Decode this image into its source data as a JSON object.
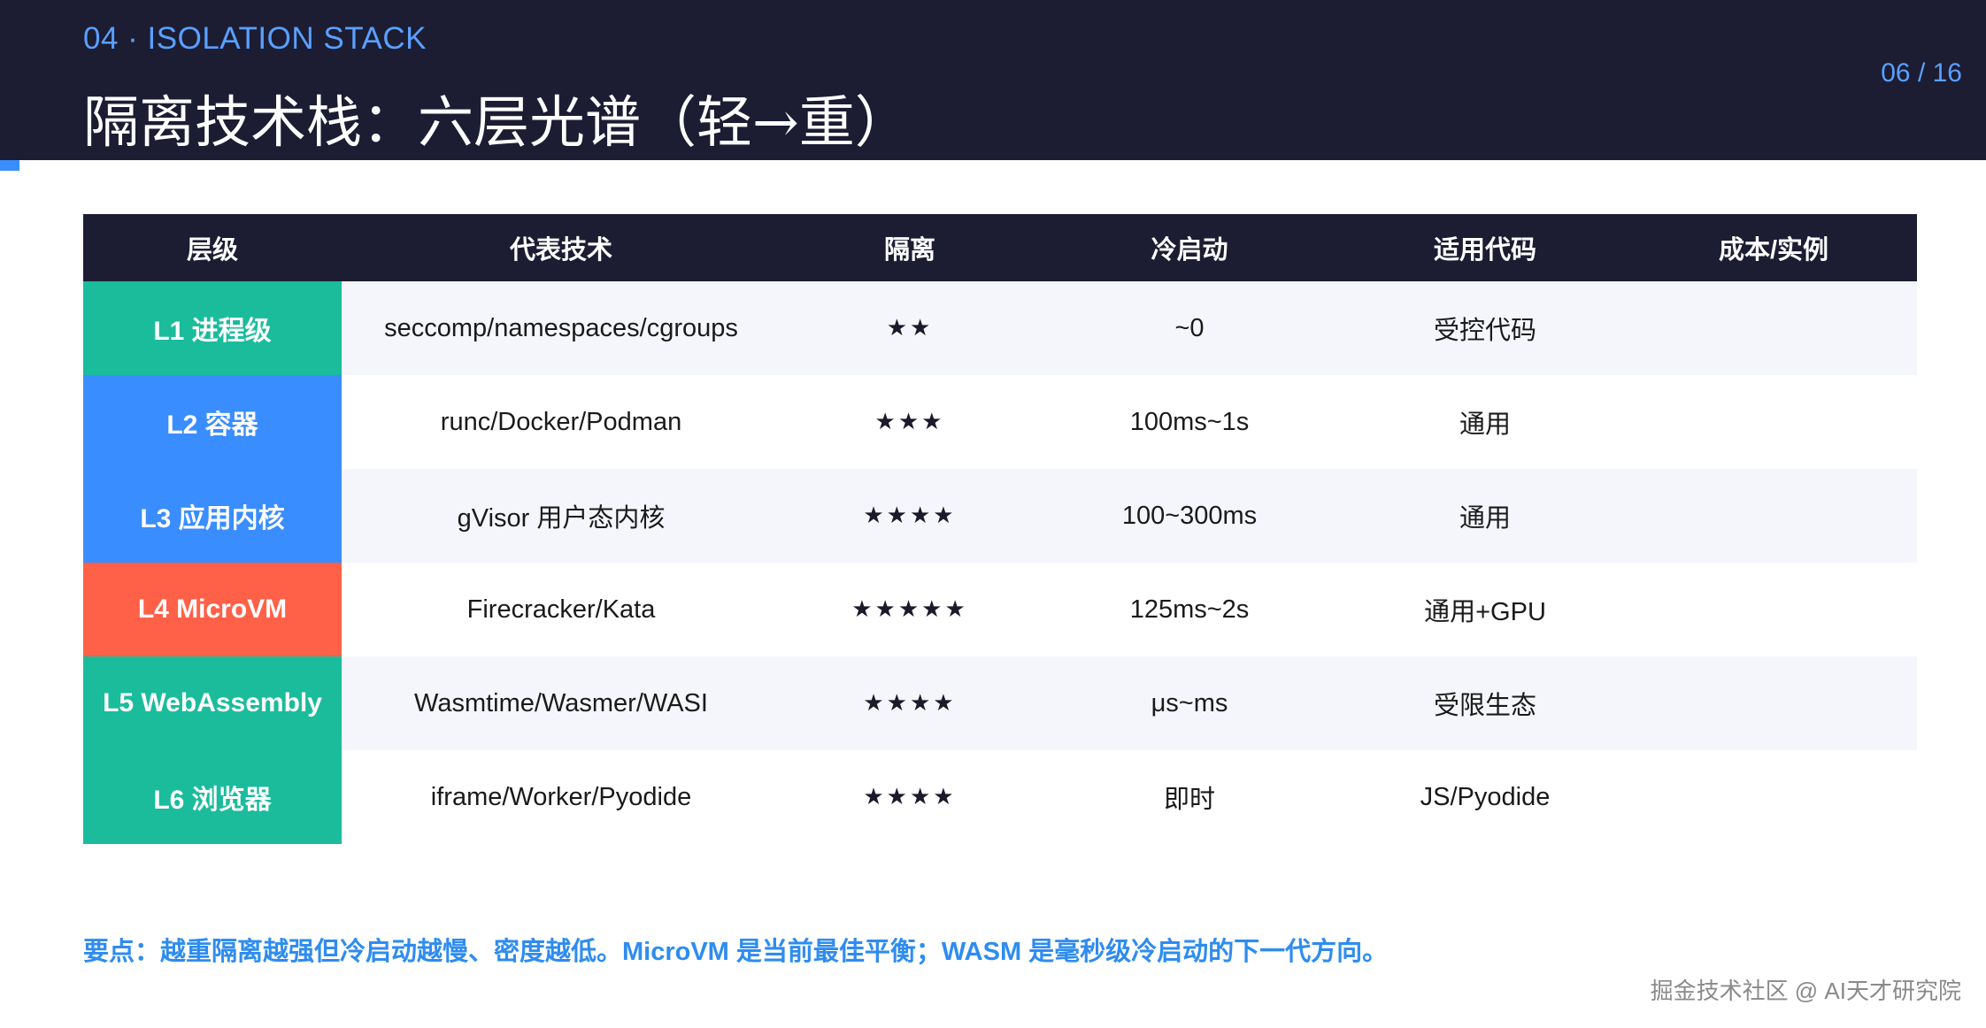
{
  "header": {
    "section_label": "04 · ISOLATION STACK",
    "title": "隔离技术栈：六层光谱（轻→重）",
    "page_counter": "06 / 16"
  },
  "table": {
    "columns": [
      "层级",
      "代表技术",
      "隔离",
      "冷启动",
      "适用代码",
      "成本/实例"
    ],
    "rows": [
      {
        "level": "L1 进程级",
        "level_color": "#1abc9c",
        "tech": "seccomp/namespaces/cgroups",
        "isolation": "★★",
        "cold_start": "~0",
        "code": "受控代码",
        "cost": ""
      },
      {
        "level": "L2 容器",
        "level_color": "#3a8dff",
        "tech": "runc/Docker/Podman",
        "isolation": "★★★",
        "cold_start": "100ms~1s",
        "code": "通用",
        "cost": ""
      },
      {
        "level": "L3 应用内核",
        "level_color": "#3a8dff",
        "tech": "gVisor 用户态内核",
        "isolation": "★★★★",
        "cold_start": "100~300ms",
        "code": "通用",
        "cost": ""
      },
      {
        "level": "L4 MicroVM",
        "level_color": "#ff6148",
        "tech": "Firecracker/Kata",
        "isolation": "★★★★★",
        "cold_start": "125ms~2s",
        "code": "通用+GPU",
        "cost": ""
      },
      {
        "level": "L5 WebAssembly",
        "level_color": "#1abc9c",
        "tech": "Wasmtime/Wasmer/WASI",
        "isolation": "★★★★",
        "cold_start": "μs~ms",
        "code": "受限生态",
        "cost": ""
      },
      {
        "level": "L6 浏览器",
        "level_color": "#1abc9c",
        "tech": "iframe/Worker/Pyodide",
        "isolation": "★★★★",
        "cold_start": "即时",
        "code": "JS/Pyodide",
        "cost": ""
      }
    ]
  },
  "footer": {
    "key_note": "要点：越重隔离越强但冷启动越慢、密度越低。MicroVM 是当前最佳平衡；WASM 是毫秒级冷启动的下一代方向。",
    "watermark": "掘金技术社区 @ AI天才研究院"
  },
  "colors": {
    "header_bg": "#1c1d33",
    "accent": "#3a8dff",
    "teal": "#1abc9c",
    "red": "#ff6148",
    "note_blue": "#2e8cf0"
  }
}
